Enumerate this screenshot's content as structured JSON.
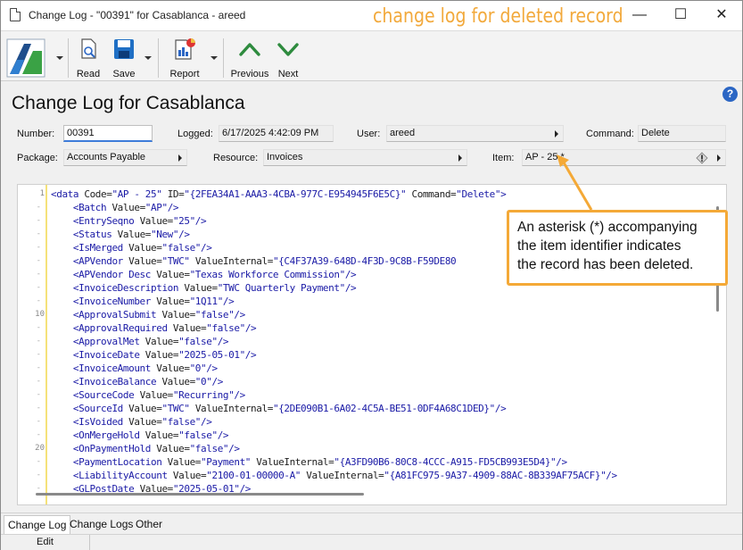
{
  "window": {
    "title": "Change Log - \"00391\" for Casablanca - areed",
    "annotation_title": "change log for deleted record",
    "minimize_glyph": "—",
    "maximize_glyph": "☐",
    "close_glyph": "✕"
  },
  "toolbar": {
    "read_label": "Read",
    "save_label": "Save",
    "report_label": "Report",
    "previous_label": "Previous",
    "next_label": "Next"
  },
  "header": {
    "title": "Change Log for Casablanca",
    "help_glyph": "?"
  },
  "fields": {
    "number_label": "Number:",
    "number_value": "00391",
    "logged_label": "Logged:",
    "logged_value": "6/17/2025 4:42:09 PM",
    "user_label": "User:",
    "user_value": "areed",
    "command_label": "Command:",
    "command_value": "Delete",
    "package_label": "Package:",
    "package_value": "Accounts Payable",
    "resource_label": "Resource:",
    "resource_value": "Invoices",
    "item_label": "Item:",
    "item_value": "AP - 25 *"
  },
  "callout": {
    "line1": "An asterisk (*) accompanying",
    "line2": "the item identifier indicates",
    "line3": "the record has been deleted."
  },
  "editor": {
    "line_number_1": "1",
    "line_number_10": "10",
    "line_number_20": "20",
    "dash": "-",
    "lines": [
      {
        "indent": "",
        "tag": "<data",
        "rest": [
          {
            "a": " Code=",
            "v": "\"AP - 25\""
          },
          {
            "a": " ID=",
            "v": "\"{2FEA34A1-AAA3-4CBA-977C-E954945F6E5C}\""
          },
          {
            "a": " Command=",
            "v": "\"Delete\""
          }
        ],
        "end": ">"
      },
      {
        "indent": "    ",
        "tag": "<Batch",
        "rest": [
          {
            "a": " Value=",
            "v": "\"AP\""
          }
        ],
        "end": "/>"
      },
      {
        "indent": "    ",
        "tag": "<EntrySeqno",
        "rest": [
          {
            "a": " Value=",
            "v": "\"25\""
          }
        ],
        "end": "/>"
      },
      {
        "indent": "    ",
        "tag": "<Status",
        "rest": [
          {
            "a": " Value=",
            "v": "\"New\""
          }
        ],
        "end": "/>"
      },
      {
        "indent": "    ",
        "tag": "<IsMerged",
        "rest": [
          {
            "a": " Value=",
            "v": "\"false\""
          }
        ],
        "end": "/>"
      },
      {
        "indent": "    ",
        "tag": "<APVendor",
        "rest": [
          {
            "a": " Value=",
            "v": "\"TWC\""
          },
          {
            "a": " ValueInternal=",
            "v": "\"{C4F37A39-648D-4F3D-9C8B-F59DE80"
          }
        ],
        "end": ""
      },
      {
        "indent": "    ",
        "tag": "<APVendor Desc",
        "rest": [
          {
            "a": " Value=",
            "v": "\"Texas Workforce Commission\""
          }
        ],
        "end": "/>"
      },
      {
        "indent": "    ",
        "tag": "<InvoiceDescription",
        "rest": [
          {
            "a": " Value=",
            "v": "\"TWC Quarterly Payment\""
          }
        ],
        "end": "/>"
      },
      {
        "indent": "    ",
        "tag": "<InvoiceNumber",
        "rest": [
          {
            "a": " Value=",
            "v": "\"1Q11\""
          }
        ],
        "end": "/>"
      },
      {
        "indent": "    ",
        "tag": "<ApprovalSubmit",
        "rest": [
          {
            "a": " Value=",
            "v": "\"false\""
          }
        ],
        "end": "/>"
      },
      {
        "indent": "    ",
        "tag": "<ApprovalRequired",
        "rest": [
          {
            "a": " Value=",
            "v": "\"false\""
          }
        ],
        "end": "/>"
      },
      {
        "indent": "    ",
        "tag": "<ApprovalMet",
        "rest": [
          {
            "a": " Value=",
            "v": "\"false\""
          }
        ],
        "end": "/>"
      },
      {
        "indent": "    ",
        "tag": "<InvoiceDate",
        "rest": [
          {
            "a": " Value=",
            "v": "\"2025-05-01\""
          }
        ],
        "end": "/>"
      },
      {
        "indent": "    ",
        "tag": "<InvoiceAmount",
        "rest": [
          {
            "a": " Value=",
            "v": "\"0\""
          }
        ],
        "end": "/>"
      },
      {
        "indent": "    ",
        "tag": "<InvoiceBalance",
        "rest": [
          {
            "a": " Value=",
            "v": "\"0\""
          }
        ],
        "end": "/>"
      },
      {
        "indent": "    ",
        "tag": "<SourceCode",
        "rest": [
          {
            "a": " Value=",
            "v": "\"Recurring\""
          }
        ],
        "end": "/>"
      },
      {
        "indent": "    ",
        "tag": "<SourceId",
        "rest": [
          {
            "a": " Value=",
            "v": "\"TWC\""
          },
          {
            "a": " ValueInternal=",
            "v": "\"{2DE090B1-6A02-4C5A-BE51-0DF4A68C1DED}\""
          }
        ],
        "end": "/>"
      },
      {
        "indent": "    ",
        "tag": "<IsVoided",
        "rest": [
          {
            "a": " Value=",
            "v": "\"false\""
          }
        ],
        "end": "/>"
      },
      {
        "indent": "    ",
        "tag": "<OnMergeHold",
        "rest": [
          {
            "a": " Value=",
            "v": "\"false\""
          }
        ],
        "end": "/>"
      },
      {
        "indent": "    ",
        "tag": "<OnPaymentHold",
        "rest": [
          {
            "a": " Value=",
            "v": "\"false\""
          }
        ],
        "end": "/>"
      },
      {
        "indent": "    ",
        "tag": "<PaymentLocation",
        "rest": [
          {
            "a": " Value=",
            "v": "\"Payment\""
          },
          {
            "a": " ValueInternal=",
            "v": "\"{A3FD90B6-80C8-4CCC-A915-FD5CB993E5D4}\""
          }
        ],
        "end": "/>"
      },
      {
        "indent": "    ",
        "tag": "<LiabilityAccount",
        "rest": [
          {
            "a": " Value=",
            "v": "\"2100-01-00000-A\""
          },
          {
            "a": " ValueInternal=",
            "v": "\"{A81FC975-9A37-4909-88AC-8B339AF75ACF}\""
          }
        ],
        "end": "/>"
      },
      {
        "indent": "    ",
        "tag": "<GLPostDate",
        "rest": [
          {
            "a": " Value=",
            "v": "\"2025-05-01\""
          }
        ],
        "end": "/>"
      }
    ]
  },
  "tabs": {
    "change_log": "Change Log",
    "change_logs": "Change Logs",
    "other": "Other"
  },
  "status": {
    "mode": "Edit"
  }
}
